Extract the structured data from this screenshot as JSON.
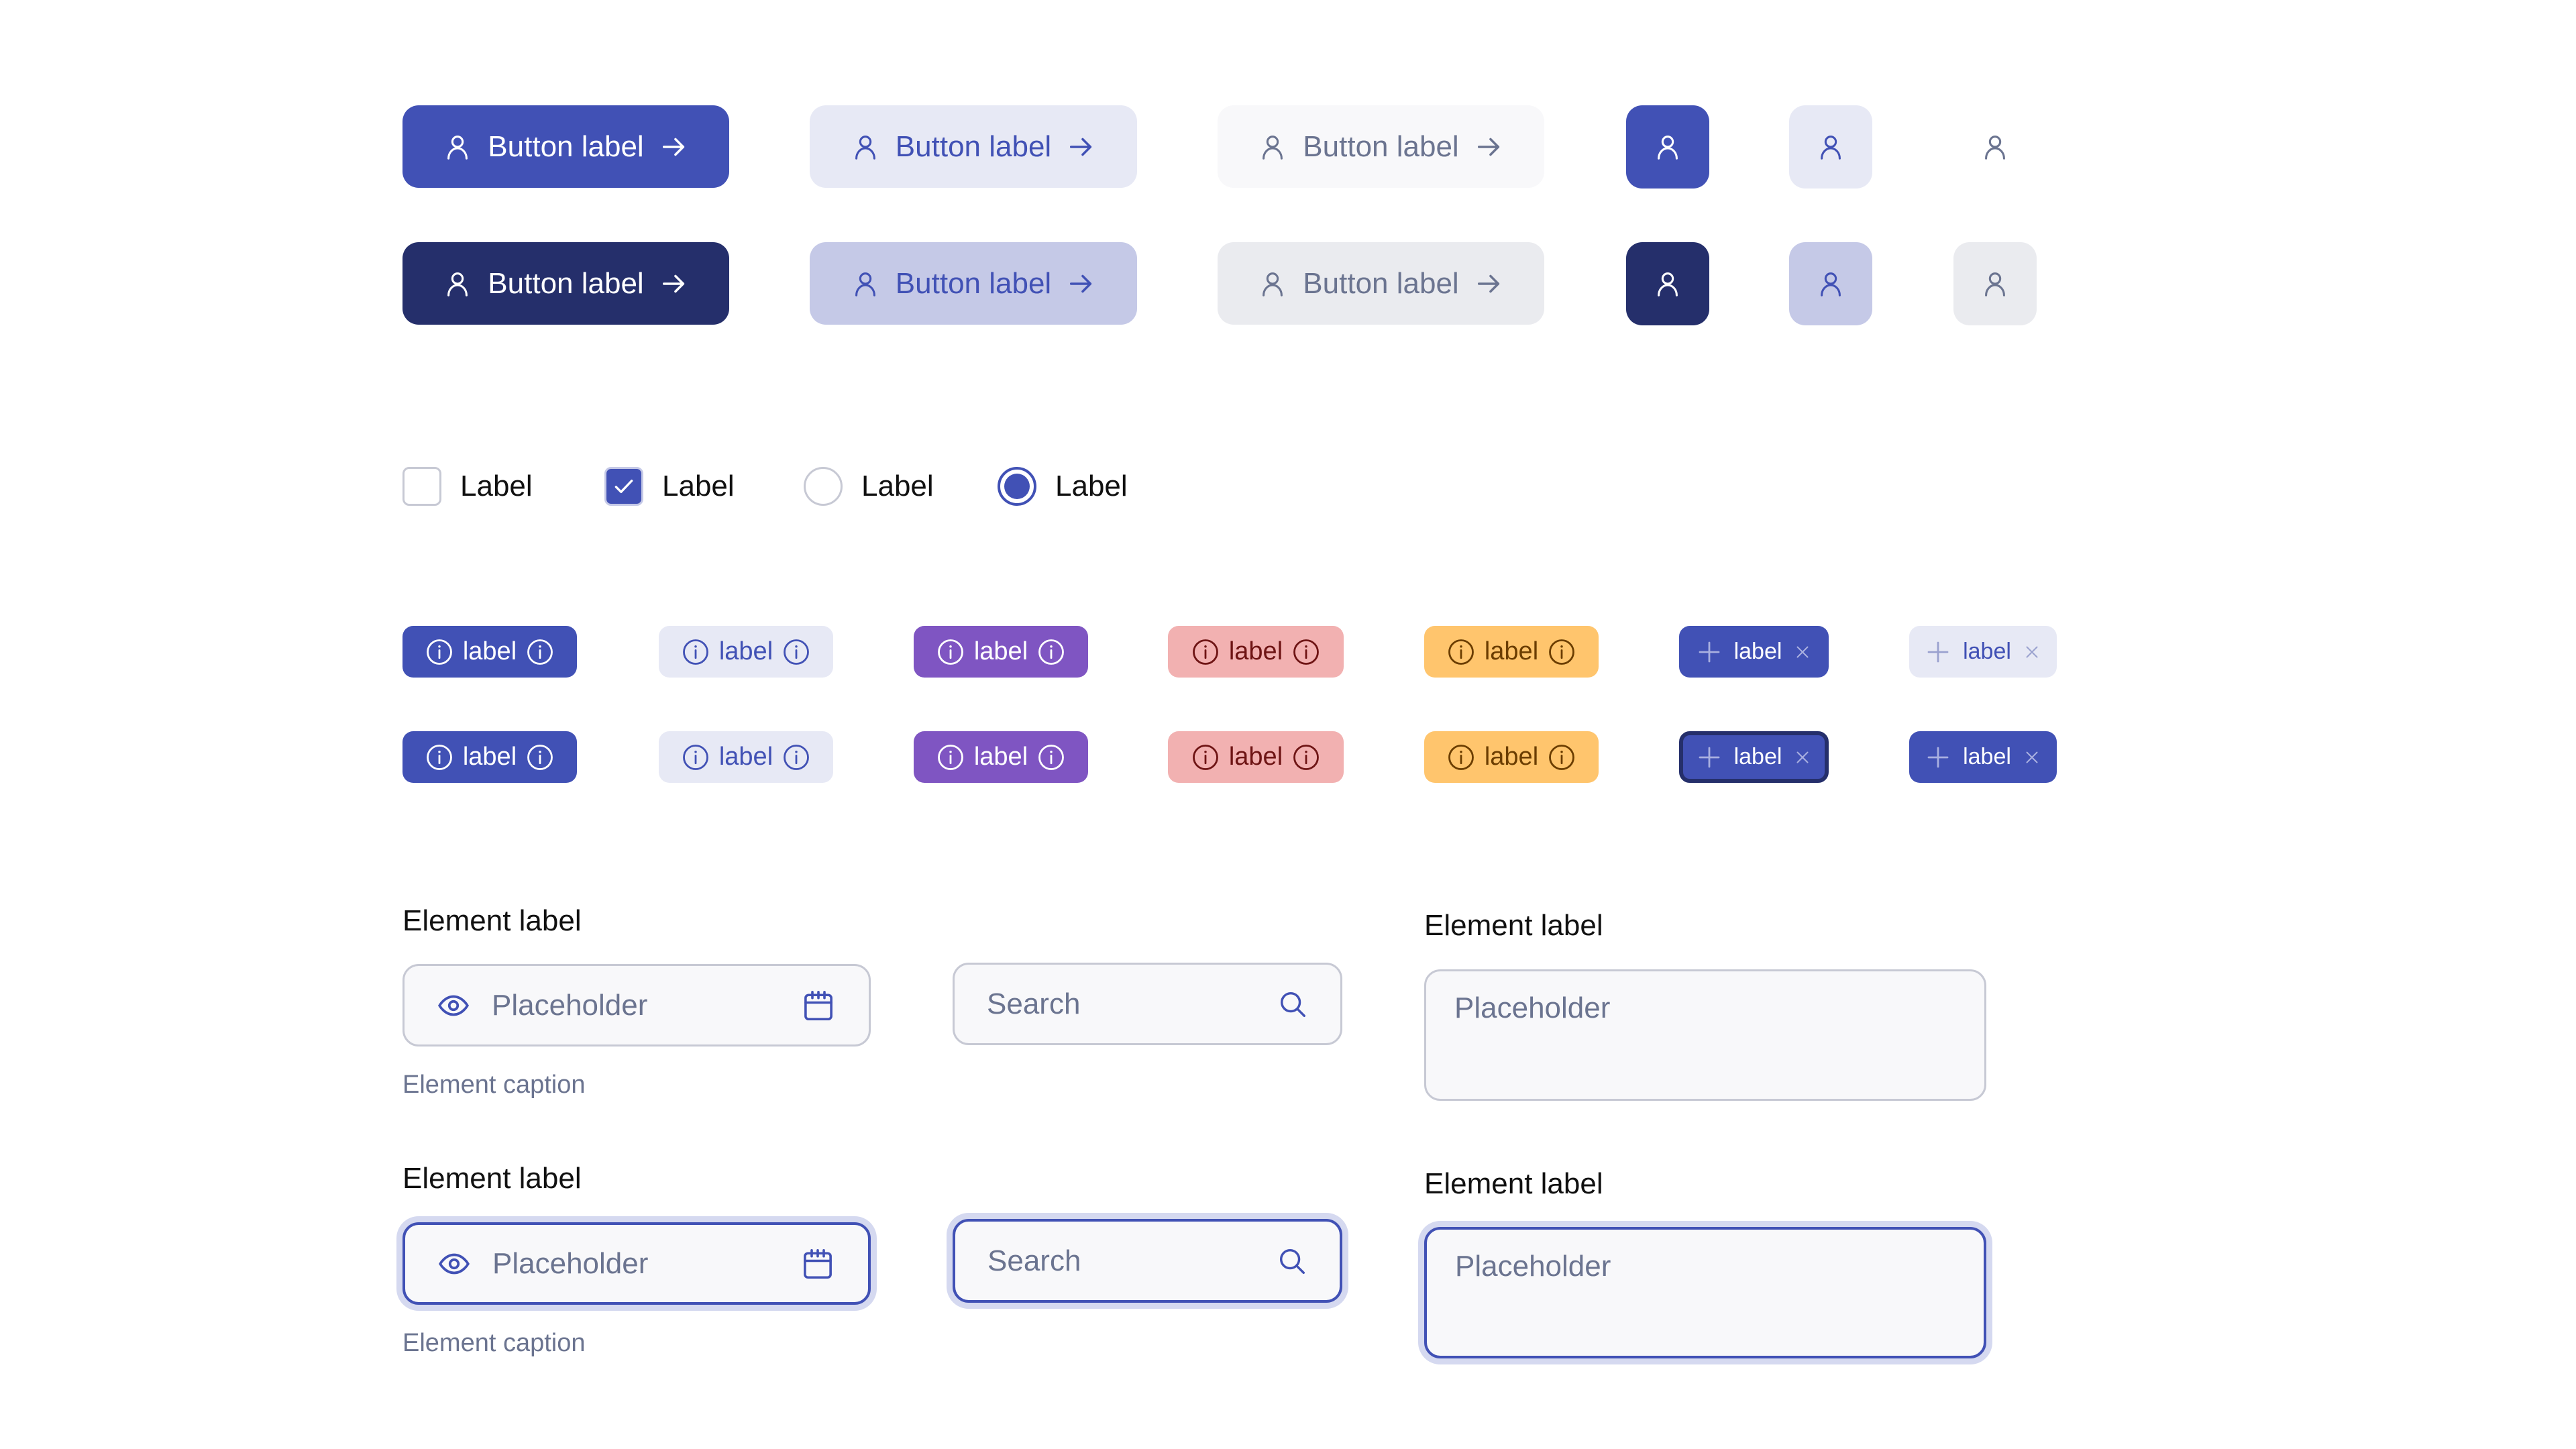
{
  "colors": {
    "primary": "#4151b5",
    "primary_pressed": "#252f6b",
    "secondary_bg": "#e7e9f5",
    "secondary_pressed_bg": "#c5c9e7",
    "tertiary_bg": "#f8f8fa",
    "tertiary_pressed_bg": "#eaebef",
    "neutral_text": "#6b7490",
    "purple": "#7f55c2",
    "red_bg": "#f2b1b1",
    "red_text": "#6e1414",
    "amber_bg": "#ffc56d",
    "amber_text": "#6b3d00",
    "focus_ring": "#d5d9f0"
  },
  "buttons": {
    "rows": [
      {
        "state": "default",
        "labels": [
          "Button label",
          "Button label",
          "Button label"
        ]
      },
      {
        "state": "pressed",
        "labels": [
          "Button label",
          "Button label",
          "Button label"
        ]
      }
    ],
    "leading_icon": "user-icon",
    "trailing_icon": "arrow-right-icon"
  },
  "selection": {
    "checkbox_unchecked_label": "Label",
    "checkbox_checked_label": "Label",
    "radio_unchecked_label": "Label",
    "radio_checked_label": "Label"
  },
  "tags": {
    "row1": [
      "label",
      "label",
      "label",
      "label",
      "label",
      "label",
      "label"
    ],
    "row2": [
      "label",
      "label",
      "label",
      "label",
      "label",
      "label",
      "label"
    ],
    "info_icon": "info-circle-icon",
    "add_icon": "plus-icon",
    "remove_icon": "close-icon"
  },
  "form": {
    "row1": {
      "input_label": "Element label",
      "input_placeholder": "Placeholder",
      "input_caption": "Element caption",
      "search_placeholder": "Search",
      "textarea_label": "Element label",
      "textarea_placeholder": "Placeholder"
    },
    "row2": {
      "input_label": "Element label",
      "input_placeholder": "Placeholder",
      "input_caption": "Element caption",
      "search_placeholder": "Search",
      "textarea_label": "Element label",
      "textarea_placeholder": "Placeholder"
    }
  }
}
